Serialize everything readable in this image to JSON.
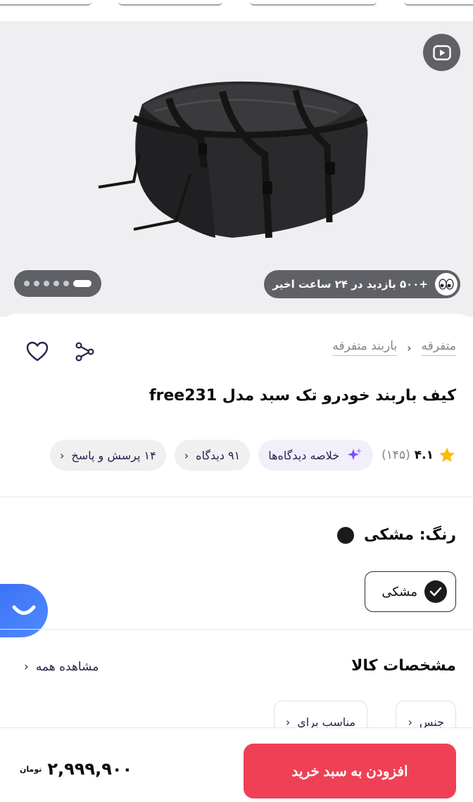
{
  "gallery": {
    "views_text": "+۵۰۰ بازدید در ۲۴ ساعت اخیر",
    "dots_count": 6
  },
  "breadcrumb": {
    "items": [
      "متفرقه",
      "باربند متفرقه"
    ]
  },
  "product": {
    "title": "کیف باربند خودرو تک سبد مدل free231"
  },
  "meta": {
    "rating_score": "۴.۱",
    "rating_count": "(۱۴۵)",
    "summary_label": "خلاصه دیدگاه‌ها",
    "reviews_label": "۹۱ دیدگاه",
    "qa_label": "۱۴ پرسش و پاسخ"
  },
  "color": {
    "label": "رنگ: مشکی",
    "option_name": "مشکی",
    "swatch": "#1b1b1b"
  },
  "specs": {
    "heading": "مشخصات کالا",
    "see_all": "مشاهده همه",
    "chips": [
      "جنس",
      "مناسب برای"
    ]
  },
  "bottom": {
    "cart_button": "افزودن به سبد خرید",
    "price": "۲,۹۹۹,۹۰۰",
    "currency": "تومان"
  },
  "colors": {
    "accent": "#ef4056",
    "chat": "#3a6ff5"
  }
}
